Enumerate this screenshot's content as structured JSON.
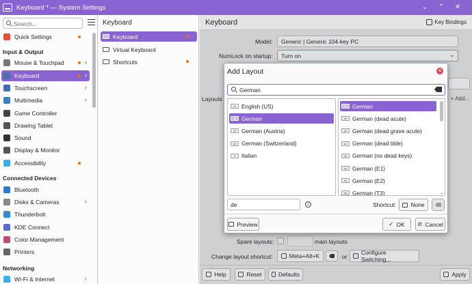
{
  "window": {
    "title": "Keyboard * — System Settings",
    "minimize": "⌄",
    "maximize": "⌃",
    "close": "✕"
  },
  "colors": {
    "accent": "#8a63d2",
    "notify": "#f67400",
    "danger": "#da4453"
  },
  "sidebar": {
    "search_placeholder": "Search...",
    "items": [
      {
        "label": "Quick Settings",
        "icon": "quick-settings-icon",
        "dot": true,
        "chevron": ""
      },
      {
        "label": "Mouse & Touchpad",
        "icon": "mouse-icon",
        "dot": true,
        "chevron": "›"
      },
      {
        "label": "Keyboard",
        "icon": "keyboard-icon",
        "dot": true,
        "chevron": "›"
      },
      {
        "label": "Touchscreen",
        "icon": "touchscreen-icon",
        "dot": false,
        "chevron": "›"
      },
      {
        "label": "Multimedia",
        "icon": "multimedia-icon",
        "dot": false,
        "chevron": "›"
      },
      {
        "label": "Game Controller",
        "icon": "gamepad-icon",
        "dot": false,
        "chevron": ""
      },
      {
        "label": "Drawing Tablet",
        "icon": "tablet-icon",
        "dot": false,
        "chevron": ""
      },
      {
        "label": "Sound",
        "icon": "sound-icon",
        "dot": false,
        "chevron": ""
      },
      {
        "label": "Display & Monitor",
        "icon": "monitor-icon",
        "dot": false,
        "chevron": ""
      },
      {
        "label": "Accessibility",
        "icon": "accessibility-icon",
        "dot": true,
        "chevron": ""
      },
      {
        "label": "Bluetooth",
        "icon": "bluetooth-icon",
        "dot": false,
        "chevron": ""
      },
      {
        "label": "Disks & Cameras",
        "icon": "disks-icon",
        "dot": false,
        "chevron": "›"
      },
      {
        "label": "Thunderbolt",
        "icon": "thunderbolt-icon",
        "dot": false,
        "chevron": ""
      },
      {
        "label": "KDE Connect",
        "icon": "kde-connect-icon",
        "dot": false,
        "chevron": ""
      },
      {
        "label": "Color Management",
        "icon": "color-management-icon",
        "dot": false,
        "chevron": ""
      },
      {
        "label": "Printers",
        "icon": "printer-icon",
        "dot": false,
        "chevron": ""
      },
      {
        "label": "Wi-Fi & Internet",
        "icon": "wifi-icon",
        "dot": false,
        "chevron": "›"
      }
    ],
    "sections": {
      "input_output": "Input & Output",
      "connected_devices": "Connected Devices",
      "networking": "Networking"
    }
  },
  "subsidebar": {
    "header": "Keyboard",
    "items": [
      {
        "label": "Keyboard",
        "dot": true
      },
      {
        "label": "Virtual Keyboard",
        "dot": false
      },
      {
        "label": "Shortcuts",
        "dot": true
      }
    ]
  },
  "main": {
    "title": "Keyboard",
    "key_bindings": "Key Bindings",
    "model_label": "Model:",
    "model_value": "Generic | Generic 104-key PC",
    "numlock_label": "NumLock on startup:",
    "numlock_value": "Turn on",
    "layouts_tab": "Layouts",
    "add_label": "+ Add...",
    "spare_label": "Spare layouts:",
    "spare_suffix": "main layouts",
    "change_shortcut_label": "Change layout shortcut:",
    "shortcut_value": "Meta+Alt+K",
    "or": "or",
    "configure_switching": "Configure Switching...",
    "help": "Help",
    "reset": "Reset",
    "defaults": "Defaults",
    "apply": "Apply"
  },
  "dialog": {
    "title": "Add Layout",
    "search_value": "German",
    "languages": [
      {
        "code": "us",
        "label": "English (US)"
      },
      {
        "code": "de",
        "label": "German"
      },
      {
        "code": "at",
        "label": "German (Austria)"
      },
      {
        "code": "ch",
        "label": "German (Switzerland)"
      },
      {
        "code": "it",
        "label": "Italian"
      }
    ],
    "layouts": [
      {
        "code": "de",
        "label": "German"
      },
      {
        "code": "de",
        "label": "German (dead acute)"
      },
      {
        "code": "de",
        "label": "German (dead grave acute)"
      },
      {
        "code": "de",
        "label": "German (dead tilde)"
      },
      {
        "code": "de",
        "label": "German (no dead keys)"
      },
      {
        "code": "de",
        "label": "German (E1)"
      },
      {
        "code": "de",
        "label": "German (E2)"
      },
      {
        "code": "de",
        "label": "German (T3)"
      }
    ],
    "selected_language": 1,
    "selected_layout": 0,
    "variant_value": "de",
    "shortcut_label": "Shortcut:",
    "shortcut_none": "None",
    "preview": "Preview",
    "ok": "OK",
    "cancel": "Cancel"
  }
}
